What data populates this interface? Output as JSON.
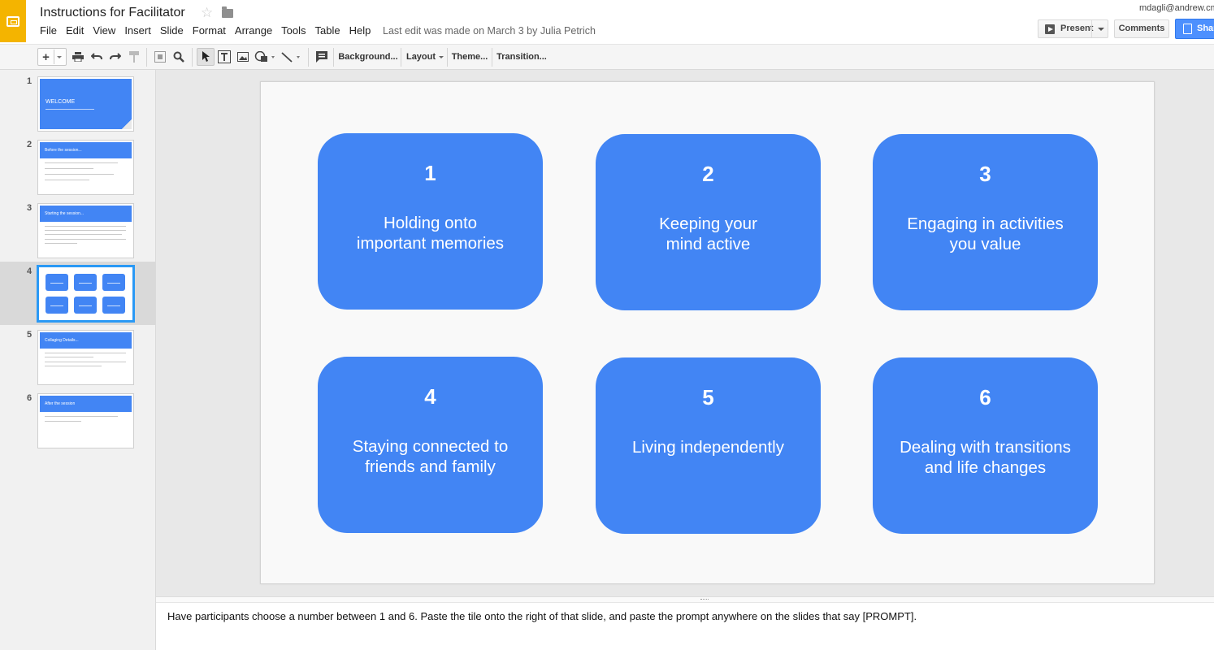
{
  "app": {
    "title": "Instructions for Facilitator",
    "last_edit": "Last edit was made on March 3 by Julia Petrich",
    "user_email": "mdagli@andrew.cmu.",
    "brand_color": "#f4b400",
    "menu": [
      "File",
      "Edit",
      "View",
      "Insert",
      "Slide",
      "Format",
      "Arrange",
      "Tools",
      "Table",
      "Help"
    ]
  },
  "buttons": {
    "present": "Present",
    "comments": "Comments",
    "share": "Shar"
  },
  "toolbar": {
    "new_slide": "+",
    "background": "Background...",
    "layout": "Layout",
    "theme": "Theme...",
    "transition": "Transition..."
  },
  "filmstrip": {
    "slides": [
      {
        "number": "1",
        "title": "WELCOME"
      },
      {
        "number": "2",
        "title": "Before the session..."
      },
      {
        "number": "3",
        "title": "Starting the session..."
      },
      {
        "number": "4",
        "title": ""
      },
      {
        "number": "5",
        "title": "Collaging Details..."
      },
      {
        "number": "6",
        "title": "After the session"
      }
    ],
    "selected": "4"
  },
  "slide": {
    "accent": "#4285f4",
    "tiles": [
      {
        "number": "1",
        "label": "Holding onto\nimportant memories"
      },
      {
        "number": "2",
        "label": "Keeping your\nmind active"
      },
      {
        "number": "3",
        "label": "Engaging in activities\nyou value"
      },
      {
        "number": "4",
        "label": "Staying connected to\nfriends and family"
      },
      {
        "number": "5",
        "label": "Living independently"
      },
      {
        "number": "6",
        "label": "Dealing with transitions\nand life changes"
      }
    ]
  },
  "notes": {
    "text": "Have participants choose a number between 1 and 6. Paste the tile onto the right of that slide, and paste the prompt anywhere on the slides that say [PROMPT]."
  }
}
